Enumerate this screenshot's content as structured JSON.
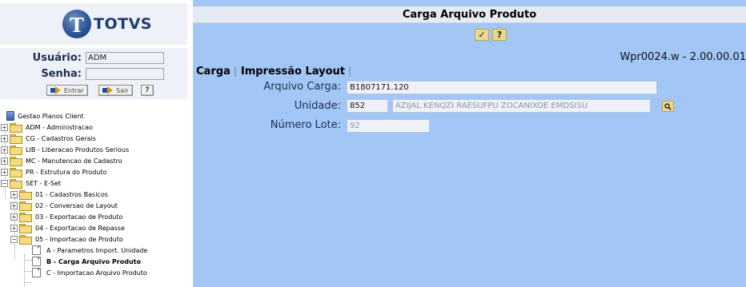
{
  "brand": {
    "logo_letter": "T",
    "logo_text": "TOTVS"
  },
  "login": {
    "user_label": "Usuário:",
    "user_value": "ADM",
    "password_label": "Senha:",
    "enter_label": "Entrar",
    "exit_label": "Sair",
    "help_label": "?"
  },
  "tree": {
    "root": "Gestao Planos Client",
    "items": [
      {
        "label": "ADM - Administracao",
        "expander": "+"
      },
      {
        "label": "CG - Cadastros Gerais",
        "expander": "+"
      },
      {
        "label": "LIB - Liberacao Produtos Serious",
        "expander": "+"
      },
      {
        "label": "MC - Manutencao de Cadastro",
        "expander": "+"
      },
      {
        "label": "PR - Estrutura do Produto",
        "expander": "+"
      },
      {
        "label": "SET - E-Set",
        "expander": "−"
      }
    ],
    "set_children": [
      {
        "label": "01 - Cadastros Basicos",
        "expander": "+"
      },
      {
        "label": "02 - Conversao de Layout",
        "expander": "+"
      },
      {
        "label": "03 - Exportacao de Produto",
        "expander": "+"
      },
      {
        "label": "04 - Exportacao de Repasse",
        "expander": "+"
      },
      {
        "label": "05 - Importacao de Produto",
        "expander": "−"
      }
    ],
    "import_children": [
      {
        "label": "A - Parametros Import. Unidade",
        "selected": false
      },
      {
        "label": "B - Carga Arquivo Produto",
        "selected": true
      },
      {
        "label": "C - Importacao Arquivo Produto",
        "selected": false
      }
    ]
  },
  "screen": {
    "title": "Carga Arquivo Produto",
    "confirm_icon": "✓",
    "help_label": "?",
    "program": "Wpr0024.w - 2.00.00.01",
    "tabs": [
      {
        "label": "Carga",
        "sep": "|"
      },
      {
        "label": "Impressão Layout",
        "sep": "|"
      }
    ],
    "form": {
      "arquivo_label": "Arquivo Carga:",
      "arquivo_value": "B1807171.120",
      "unidade_label": "Unidade:",
      "unidade_code": "852",
      "unidade_name": "AZIJAL KENQZI RAESUFPU ZOCANIXOE EMDSISU",
      "lote_label": "Número Lote:",
      "lote_value": "92"
    }
  },
  "colors": {
    "accent_blue": "#a2c6f6",
    "button_yellow": "#ecd88b",
    "panel_grey": "#eef1f7"
  }
}
